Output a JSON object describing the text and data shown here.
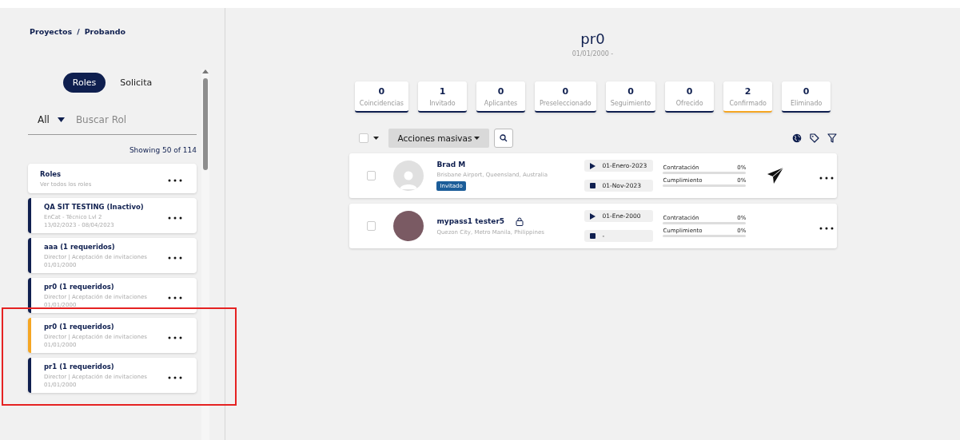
{
  "breadcrumb": {
    "items": [
      "Proyectos",
      "Probando"
    ],
    "separator": "/"
  },
  "sidebar": {
    "tabs": [
      {
        "label": "Roles",
        "selected": true
      },
      {
        "label": "Solicita",
        "selected": false
      }
    ],
    "filter": "All",
    "search": {
      "placeholder": "Buscar Rol"
    },
    "showing": "Showing 50 of 114",
    "roles": [
      {
        "kind": "all",
        "title": "Roles",
        "lines": [
          "Ver todos los roles"
        ],
        "selected": false
      },
      {
        "kind": "role",
        "title": "QA SIT TESTING (Inactivo)",
        "lines": [
          "EnCat - Técnico Lvl 2",
          "13/02/2023 - 08/04/2023"
        ],
        "selected": false
      },
      {
        "kind": "role",
        "title": "aaa (1 requeridos)",
        "lines": [
          "Director | Aceptación de invitaciones",
          "01/01/2000"
        ],
        "selected": false
      },
      {
        "kind": "role",
        "title": "pr0 (1 requeridos)",
        "lines": [
          "Director | Aceptación de invitaciones",
          "01/01/2000"
        ],
        "selected": false
      },
      {
        "kind": "role",
        "title": "pr0 (1 requeridos)",
        "lines": [
          "Director | Aceptación de invitaciones",
          "01/01/2000"
        ],
        "selected": true
      },
      {
        "kind": "role",
        "title": "pr1 (1 requeridos)",
        "lines": [
          "Director | Aceptación de invitaciones",
          "01/01/2000"
        ],
        "selected": false
      }
    ]
  },
  "header": {
    "title": "pr0",
    "date": "01/01/2000 -"
  },
  "stages": [
    {
      "count": "0",
      "label": "Coincidencias",
      "selected": false
    },
    {
      "count": "1",
      "label": "Invitado",
      "selected": false
    },
    {
      "count": "0",
      "label": "Aplicantes",
      "selected": false
    },
    {
      "count": "0",
      "label": "Preseleccionado",
      "selected": false
    },
    {
      "count": "0",
      "label": "Seguimiento",
      "selected": false
    },
    {
      "count": "0",
      "label": "Ofrecido",
      "selected": false
    },
    {
      "count": "2",
      "label": "Confirmado",
      "selected": true
    },
    {
      "count": "0",
      "label": "Eliminado",
      "selected": false
    }
  ],
  "toolbar": {
    "select_all": false,
    "bulk_actions": "Acciones masivas"
  },
  "candidates": [
    {
      "checked": false,
      "photo": false,
      "name": "Brad M",
      "locked": false,
      "location": "Brisbane Airport, Queensland, Australia",
      "badge": "Invitado",
      "start": "01-Enero-2023",
      "end": "01-Nov-2023",
      "metrics": [
        {
          "label": "Contratación",
          "reading": "0%",
          "level": 0
        },
        {
          "label": "Cumplimiento",
          "reading": "0%",
          "level": 0
        }
      ],
      "send_action": true
    },
    {
      "checked": false,
      "photo": true,
      "name": "mypass1 tester5",
      "locked": true,
      "location": "Quezon City, Metro Manila, Philippines",
      "start": "01-Ene-2000",
      "end": "-",
      "metrics": [
        {
          "label": "Contratación",
          "reading": "0%",
          "level": 0
        },
        {
          "label": "Cumplimiento",
          "reading": "0%",
          "level": 0
        }
      ],
      "send_action": false
    }
  ]
}
